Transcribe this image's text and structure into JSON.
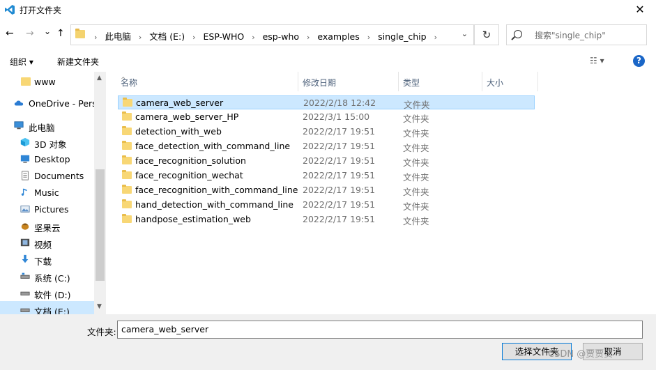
{
  "window": {
    "title": "打开文件夹",
    "close": "✕"
  },
  "nav": {
    "back": "←",
    "forward": "→",
    "recent": "⌄",
    "up": "↑",
    "breadcrumbs": [
      "此电脑",
      "文档 (E:)",
      "ESP-WHO",
      "esp-who",
      "examples",
      "single_chip"
    ],
    "separator": "›",
    "address_dropdown": "⌄",
    "refresh": "↻",
    "search_placeholder": "搜索\"single_chip\""
  },
  "toolbar": {
    "organize": "组织 ▾",
    "new_folder": "新建文件夹",
    "view_options": "☷ ▾",
    "help": "?"
  },
  "sidebar": {
    "items": [
      {
        "label": "www",
        "icon": "folder-icon"
      },
      {
        "label": "OneDrive - Perso",
        "icon": "cloud-icon"
      },
      {
        "label": "此电脑",
        "icon": "computer-icon"
      },
      {
        "label": "3D 对象",
        "icon": "cube-icon"
      },
      {
        "label": "Desktop",
        "icon": "desktop-icon"
      },
      {
        "label": "Documents",
        "icon": "documents-icon"
      },
      {
        "label": "Music",
        "icon": "music-icon"
      },
      {
        "label": "Pictures",
        "icon": "pictures-icon"
      },
      {
        "label": "坚果云",
        "icon": "nut-cloud-icon"
      },
      {
        "label": "视频",
        "icon": "video-icon"
      },
      {
        "label": "下载",
        "icon": "download-icon"
      },
      {
        "label": "系统 (C:)",
        "icon": "drive-icon"
      },
      {
        "label": "软件 (D:)",
        "icon": "drive-icon"
      },
      {
        "label": "文档 (E:)",
        "icon": "drive-icon"
      }
    ],
    "selected_index": 13,
    "scroll_up": "▲",
    "scroll_down": "▼"
  },
  "list": {
    "columns": {
      "name": "名称",
      "date": "修改日期",
      "type": "类型",
      "size": "大小"
    },
    "sort_indicator": "^",
    "rows": [
      {
        "name": "camera_web_server",
        "date": "2022/2/18 12:42",
        "type": "文件夹"
      },
      {
        "name": "camera_web_server_HP",
        "date": "2022/3/1 15:00",
        "type": "文件夹"
      },
      {
        "name": "detection_with_web",
        "date": "2022/2/17 19:51",
        "type": "文件夹"
      },
      {
        "name": "face_detection_with_command_line",
        "date": "2022/2/17 19:51",
        "type": "文件夹"
      },
      {
        "name": "face_recognition_solution",
        "date": "2022/2/17 19:51",
        "type": "文件夹"
      },
      {
        "name": "face_recognition_wechat",
        "date": "2022/2/17 19:51",
        "type": "文件夹"
      },
      {
        "name": "face_recognition_with_command_line",
        "date": "2022/2/17 19:51",
        "type": "文件夹"
      },
      {
        "name": "hand_detection_with_command_line",
        "date": "2022/2/17 19:51",
        "type": "文件夹"
      },
      {
        "name": "handpose_estimation_web",
        "date": "2022/2/17 19:51",
        "type": "文件夹"
      }
    ],
    "selected_index": 0
  },
  "footer": {
    "folder_label": "文件夹:",
    "folder_value": "camera_web_server",
    "select_button": "选择文件夹",
    "cancel_button": "取消"
  },
  "watermark": "CSDN @贾贾贾",
  "colors": {
    "accent": "#0078d7",
    "selection": "#cce8ff",
    "folder": "#f8d775",
    "help": "#1a66c7"
  }
}
